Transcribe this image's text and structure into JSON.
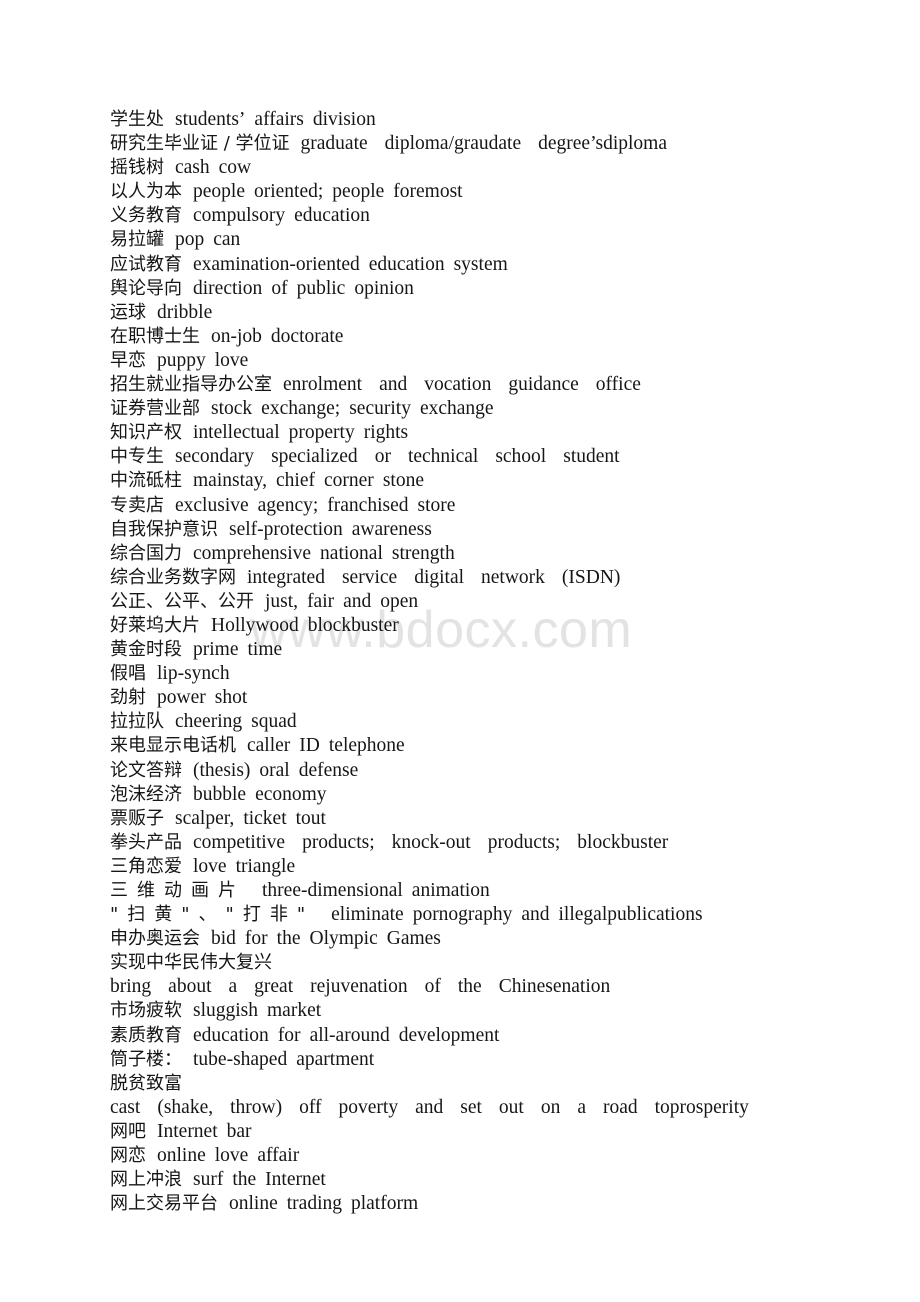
{
  "document": {
    "type": "chinese-english-glossary",
    "watermark": "www.bdocx.com",
    "watermark_color": "#e3e3e3",
    "text_color": "#161616",
    "background_color": "#ffffff"
  },
  "entries": [
    {
      "term": "学生处",
      "gloss": "students’  affairs  division"
    },
    {
      "term": "研究生毕业证  /  学位证",
      "gloss": "graduate  diploma/graudate  degree’sdiploma"
    },
    {
      "term": "摇钱树",
      "gloss": "cash  cow"
    },
    {
      "term": "以人为本",
      "gloss": "people  oriented;  people  foremost"
    },
    {
      "term": "义务教育",
      "gloss": "compulsory  education"
    },
    {
      "term": "易拉罐",
      "gloss": "pop  can"
    },
    {
      "term": "应试教育",
      "gloss": "examination-oriented  education  system"
    },
    {
      "term": "舆论导向",
      "gloss": "direction  of  public  opinion"
    },
    {
      "term": "运球",
      "gloss": "dribble"
    },
    {
      "term": "在职博士生",
      "gloss": "on-job  doctorate"
    },
    {
      "term": "早恋",
      "gloss": "puppy  love"
    },
    {
      "term": "招生就业指导办公室",
      "gloss": "enrolment  and  vocation  guidance  office"
    },
    {
      "term": "证券营业部",
      "gloss": "stock  exchange;  security  exchange"
    },
    {
      "term": "知识产权",
      "gloss": "intellectual  property  rights"
    },
    {
      "term": "中专生",
      "gloss": "secondary  specialized  or  technical  school  student"
    },
    {
      "term": "中流砥柱",
      "gloss": "mainstay,  chief  corner  stone"
    },
    {
      "term": "专卖店",
      "gloss": "exclusive  agency;  franchised  store"
    },
    {
      "term": "自我保护意识",
      "gloss": "self-protection  awareness"
    },
    {
      "term": "综合国力",
      "gloss": "comprehensive  national  strength"
    },
    {
      "term": "综合业务数字网",
      "gloss": "integrated  service  digital  network  (ISDN)"
    },
    {
      "term": "公正、公平、公开",
      "gloss": "just,  fair  and  open"
    },
    {
      "term": "好莱坞大片",
      "gloss": "Hollywood  blockbuster"
    },
    {
      "term": "黄金时段",
      "gloss": "prime  time"
    },
    {
      "term": "假唱",
      "gloss": "lip-synch"
    },
    {
      "term": "劲射",
      "gloss": "power  shot"
    },
    {
      "term": "拉拉队",
      "gloss": "cheering  squad"
    },
    {
      "term": "来电显示电话机",
      "gloss": "caller  ID  telephone"
    },
    {
      "term": "论文答辩",
      "gloss": "(thesis)  oral  defense"
    },
    {
      "term": "泡沫经济",
      "gloss": "bubble  economy"
    },
    {
      "term": "票贩子",
      "gloss": "scalper,  ticket  tout"
    },
    {
      "term": "拳头产品",
      "gloss": "competitive  products;  knock-out  products;  blockbuster"
    },
    {
      "term": "三角恋爱",
      "gloss": "love  triangle"
    },
    {
      "term": "三维动画片",
      "gloss": "three-dimensional  animation",
      "spread": true
    },
    {
      "term": "\"扫黄\"、\"打非\"",
      "gloss": "eliminate  pornography  and  illegalpublications",
      "spread": true
    },
    {
      "term": "申办奥运会",
      "gloss": "bid  for  the  Olympic  Games"
    },
    {
      "term": "实现中华民伟大复兴",
      "gloss": "bring  about  a  great  rejuvenation  of  the  Chinesenation"
    },
    {
      "term": "市场疲软",
      "gloss": "sluggish  market"
    },
    {
      "term": "素质教育",
      "gloss": "education  for  all-around  development"
    },
    {
      "term": "筒子楼：",
      "gloss": "tube-shaped  apartment"
    },
    {
      "term": "脱贫致富",
      "gloss": "cast  (shake,  throw)  off  poverty  and  set  out  on  a  road  toprosperity"
    },
    {
      "term": "网吧",
      "gloss": "Internet  bar"
    },
    {
      "term": "网恋",
      "gloss": "online  love  affair"
    },
    {
      "term": "网上冲浪",
      "gloss": "surf  the  Internet"
    },
    {
      "term": "网上交易平台",
      "gloss": "online  trading  platform"
    }
  ]
}
